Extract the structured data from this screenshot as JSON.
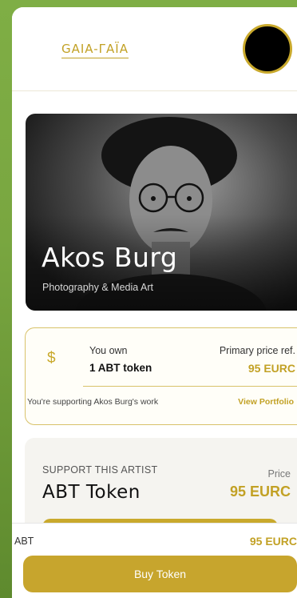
{
  "header": {
    "brand": "GAIA-ΓAÏA"
  },
  "artist": {
    "name": "Akos Burg",
    "discipline": "Photography & Media Art"
  },
  "ownership": {
    "own_label": "You own",
    "own_value": "1 ABT token",
    "price_ref_label": "Primary price ref.",
    "price_ref_value": "95 EURC",
    "supporting_text": "You're supporting Akos Burg's work",
    "portfolio_link": "View Portfolio",
    "icon": "dollar-icon"
  },
  "support": {
    "title": "SUPPORT THIS ARTIST",
    "price_label": "Price",
    "token_name": "ABT Token",
    "token_price": "95 EURC"
  },
  "bottom_bar": {
    "token_symbol": "ABT",
    "price": "95 EURC",
    "buy_label": "Buy Token"
  },
  "colors": {
    "accent": "#c2a125",
    "button": "#c7a52d",
    "page_background": "#7fae45"
  }
}
